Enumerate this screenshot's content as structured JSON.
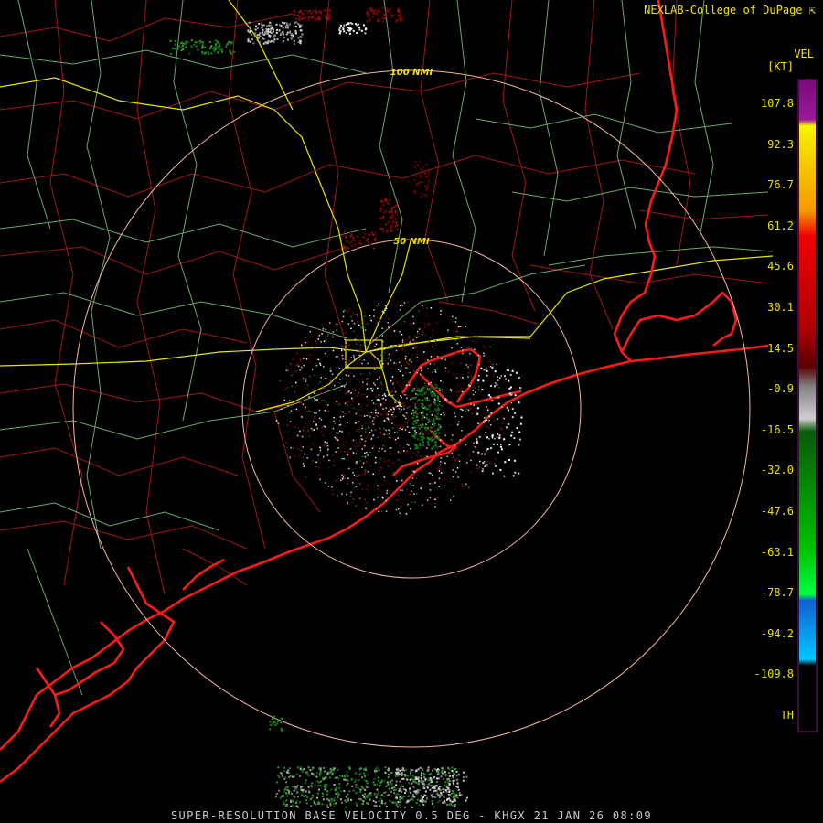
{
  "credit": "NEXLAB-College of DuPage",
  "credit_icon": "cursor-icon",
  "product": {
    "code": "VEL",
    "unit": "[KT]"
  },
  "legend": {
    "labels": [
      "107.8",
      "92.3",
      "76.7",
      "61.2",
      "45.6",
      "30.1",
      "14.5",
      "-0.9",
      "-16.5",
      "-32.0",
      "-47.6",
      "-63.1",
      "-78.7",
      "-94.2",
      "-109.8",
      "TH"
    ],
    "colors": {
      "purple": "#8a0b8a",
      "yellow": "#f5f500",
      "orange": "#f59a00",
      "red": "#f00000",
      "dark_red": "#5a0000",
      "gray": "#808080",
      "dark_green": "#0a5a0a",
      "green": "#00e000",
      "blue": "#1060d0",
      "cyan": "#00c8ff"
    }
  },
  "range_rings": [
    {
      "label": "50 NMI",
      "radius_nmi": 50
    },
    {
      "label": "100 NMI",
      "radius_nmi": 100
    }
  ],
  "footer": "SUPER-RESOLUTION BASE VELOCITY 0.5 DEG - KHGX 21 JAN 26 08:09",
  "colors": {
    "background": "#000000",
    "coastline": "#ff1a1a",
    "county_lines": "#a01818",
    "highways": "#e6e600",
    "roads": "#7fc67f",
    "rings": "#f0b8a0",
    "text": "#f2e200"
  }
}
